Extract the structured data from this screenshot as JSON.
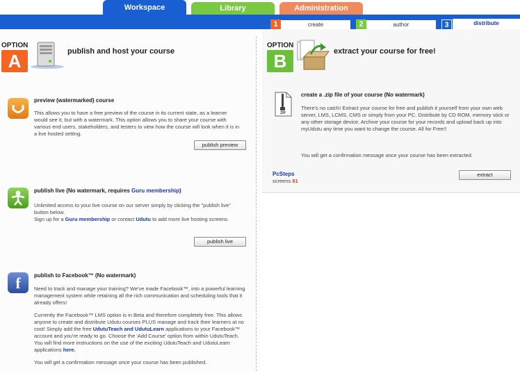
{
  "top_tabs": [
    {
      "label": "Workspace",
      "color": "#1a5fd1"
    },
    {
      "label": "Library",
      "color": "#7ac943"
    },
    {
      "label": "Administration",
      "color": "#f08a5d"
    }
  ],
  "sub_tabs": [
    {
      "num": "1",
      "label": "create",
      "color": "#f26522"
    },
    {
      "num": "2",
      "label": "author",
      "color": "#7ac943"
    },
    {
      "num": "3",
      "label": "distribute",
      "color": "#1a5fd1"
    }
  ],
  "option_a": {
    "word": "OPTION",
    "letter": "A",
    "heading": "publish and host your course",
    "preview": {
      "title": "preview (watermarked) course",
      "text": "This allows you to have a free preview of the course in its current state, as a learner would see it, but with a watermark. This option allows you to share your course with various end users, stakeholders, and testers to view how the course will look when it is in a live hosted setting.",
      "button": "publish preview"
    },
    "live": {
      "title_a": "publish live (No watermark, requires ",
      "title_link": "Guru membership",
      "title_b": ")",
      "text1": "Unlimited access to your live course on our server simply by clicking the \"publish live\" button below.",
      "text2_a": "Sign up for a ",
      "text2_link1": "Guru membership",
      "text2_b": " or contact ",
      "text2_link2": "Udutu",
      "text2_c": " to add more live hosting screens.",
      "button": "publish live"
    },
    "facebook": {
      "title": "publish to Facebook™ (No watermark)",
      "text1": "Need to track and manage your training? We've made Facebook™, into a powerful learning management system while retaining all the rich communication and scheduling tools that it already offers!",
      "text2_a": "Currently the Facebook™ LMS option is in Beta and therefore completely free. This allows anyone to create and distribute Udutu courses PLUS manage and track their learners at no cost! Simply add the free ",
      "text2_link1": "UdutuTeach and UdutuLearn",
      "text2_b": " applications to your Facebook™ account and you're ready to go. Choose the 'Add Course' option from within UdutuTeach. You will find more instructions on the use of the exciting UdutuTeach and UdutuLearn applications ",
      "text2_link2": "here.",
      "text3": "You will get a confirmation message once your course has been published."
    }
  },
  "option_b": {
    "word": "OPTION",
    "letter": "B",
    "heading": "extract your course for free!",
    "zip": {
      "icon_label": "ZIP",
      "title": "create a .zip file of your course (No watermark)",
      "text1": "There's no catch! Extract your course for free and publish it yourself from your own web server, LMS, LCMS, CMS or simply from your PC. Distribute by CD ROM, memory stick or any other storage device. Archive your course for your records and upload back up into myUdutu any time you want to change the course. All for Free!!",
      "text2": "You will get a confirmation message once your course has been extracted."
    },
    "course_name": "PcSteps",
    "screens_label": "screens",
    "screens_count": "81",
    "button": "extract"
  }
}
